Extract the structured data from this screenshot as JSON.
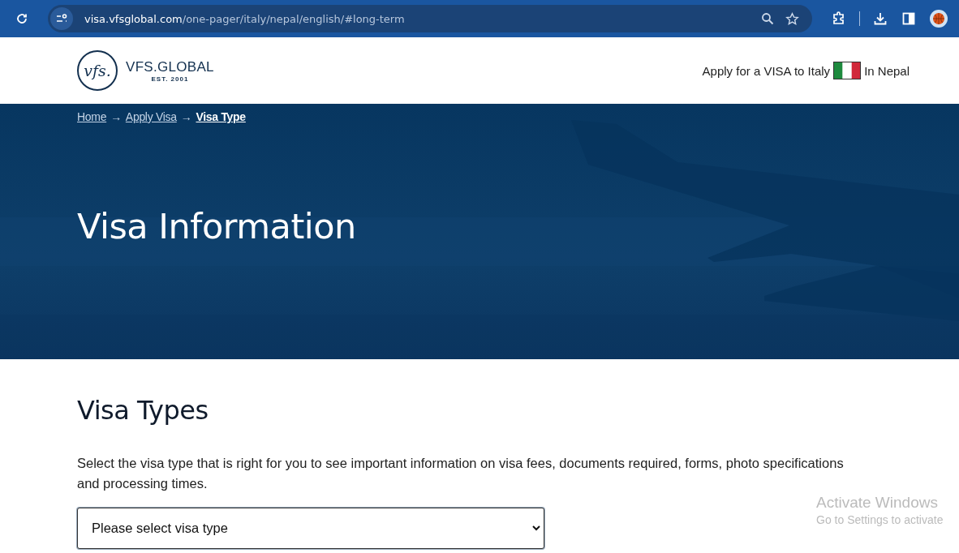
{
  "browser": {
    "url_host": "visa.vfsglobal.com",
    "url_path": "/one-pager/italy/nepal/english/#long-term"
  },
  "header": {
    "logo": {
      "mark": "vfs.",
      "name": "VFS.GLOBAL",
      "est": "EST. 2001"
    },
    "apply_text": "Apply for a VISA to Italy",
    "location_text": "In Nepal"
  },
  "breadcrumbs": [
    {
      "kind": "link",
      "label": "Home",
      "selected": false
    },
    {
      "kind": "separator",
      "label": "→"
    },
    {
      "kind": "link",
      "label": "Apply Visa",
      "selected": false
    },
    {
      "kind": "separator",
      "label": "→"
    },
    {
      "kind": "link",
      "label": "Visa Type",
      "selected": true
    }
  ],
  "hero": {
    "title": "Visa Information",
    "kind": "picture"
  },
  "section": {
    "title": "Visa Types",
    "description": "Select the visa type that is right for you to see important information on visa fees, documents required, forms, photo specifications and processing times.",
    "select": {
      "placeholder": "Please select visa type"
    }
  },
  "os_notice": {
    "title": "Activate Windows",
    "subtitle": "Go to Settings to activate"
  }
}
